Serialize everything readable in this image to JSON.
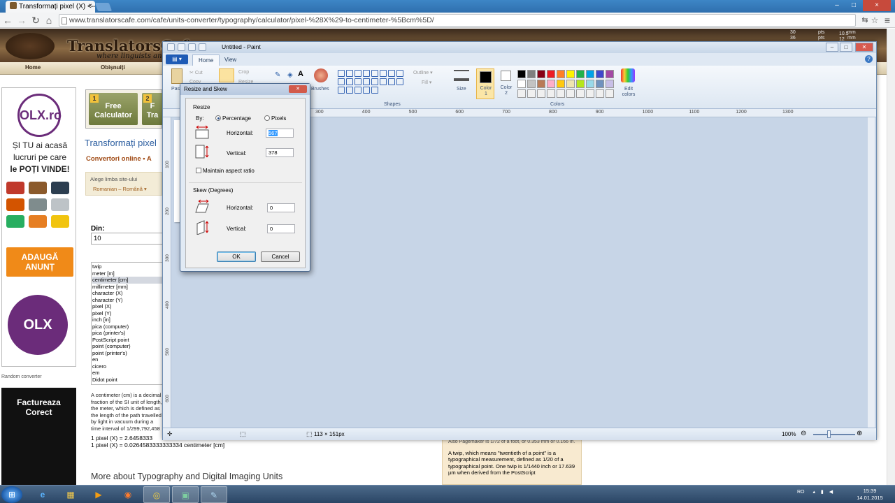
{
  "browser": {
    "tab_title": "Transformați pixel (X) <--",
    "tab_close": "×",
    "url": "www.translatorscafe.com/cafe/units-converter/typography/calculator/pixel-%28X%29-to-centimeter-%5Bcm%5D/",
    "win_min": "–",
    "win_max": "□",
    "win_close": "×"
  },
  "site": {
    "logo": "TranslatorsCafe",
    "tagline": "where linguists and",
    "nav": [
      "Home",
      "Obișnuiți"
    ],
    "right_widget": [
      "30",
      "pts",
      "mm",
      "36",
      "pts",
      "mm",
      "10.5",
      "12",
      "mm"
    ]
  },
  "ad_left": {
    "olx": "OLX.ro",
    "text_lines": [
      "ȘI TU ai acasă",
      "lucruri pe care",
      "le POȚI VINDE!"
    ],
    "button": [
      "ADAUGĂ",
      "ANUNȚ"
    ],
    "badge": "OLX",
    "random_converter": "Random converter",
    "ad2": [
      "Factureaza",
      "Corect"
    ]
  },
  "calc_tiles": [
    {
      "num": "1",
      "label_1": "Free",
      "label_2": "Calculator"
    },
    {
      "num": "2",
      "label_1": "F",
      "label_2": "Tra"
    }
  ],
  "main": {
    "heading": "Transformați pixel",
    "subnav": "Convertori online • A",
    "lang_label": "Alege limba site-ului",
    "lang_select": "Romanian – Română",
    "from_label": "Din:",
    "from_value": "10",
    "units": [
      "twip",
      "meter [m]",
      "centimeter [cm]",
      "millimeter [mm]",
      "character (X)",
      "character (Y)",
      "pixel (X)",
      "pixel (Y)",
      "inch [in]",
      "pica (computer)",
      "pica (printer's)",
      "PostScript point",
      "point (computer)",
      "point (printer's)",
      "en",
      "cicero",
      "em",
      "Didot point"
    ],
    "selected_unit": "centimeter [cm]",
    "definition": "A centimeter (cm) is a decimal fraction of the SI unit of length, the meter, which is defined as the length of the path travelled by light in vacuum during a time interval of 1/299,792,458 of a second. For comparison and conversion",
    "result_1": "1 pixel (X) = 2.6458333",
    "result_2": "1 pixel (X) = 0.0264583333333334 centimeter [cm]",
    "more_about": "More about Typography and Digital Imaging Units",
    "twip_top": "Also Pagemaker is 1/72 of a foot, or 0.353 mm or 0.166 in.",
    "twip_text": "A twip, which means \"twentieth of a point\" is a typographical measurement, defined as 1/20 of a typographical point. One twip is 1/1440 inch or 17.639 µm when derived from the PostScript"
  },
  "paint": {
    "title": "Untitled - Paint",
    "file_menu": "▤ ▾",
    "tabs": [
      "Home",
      "View"
    ],
    "clipboard": {
      "paste": "Paste",
      "cut": "Cut",
      "copy": "Copy"
    },
    "image": {
      "crop": "Crop",
      "resize": "Resize"
    },
    "brushes": "Brushes",
    "outline": "Outline",
    "fill": "Fill",
    "shapes": "Shapes",
    "size": "Size",
    "color1": [
      "Color",
      "1"
    ],
    "color2": [
      "Color",
      "2"
    ],
    "colors_label": "Colors",
    "edit_colors": [
      "Edit",
      "colors"
    ],
    "ruler_top": [
      "300",
      "400",
      "500",
      "600",
      "700",
      "800",
      "900",
      "1000",
      "1100",
      "1200",
      "1300"
    ],
    "ruler_left": [
      "100",
      "200",
      "300",
      "400",
      "500",
      "600"
    ],
    "image_size": "113 × 151px",
    "zoom": "100%",
    "zoom_minus": "⊖",
    "zoom_plus": "⊕",
    "colors": {
      "palette": [
        "#000000",
        "#7f7f7f",
        "#880015",
        "#ed1c24",
        "#ff7f27",
        "#fff200",
        "#22b14c",
        "#00a2e8",
        "#3f48cc",
        "#a349a4",
        "#ffffff",
        "#c3c3c3",
        "#b97a57",
        "#ffaec9",
        "#ffc90e",
        "#efe4b0",
        "#b5e61d",
        "#99d9ea",
        "#7092be",
        "#c8bfe7",
        "#f0f0f0",
        "#f0f0f0",
        "#f0f0f0",
        "#f0f0f0",
        "#f0f0f0",
        "#f0f0f0",
        "#f0f0f0",
        "#f0f0f0",
        "#f0f0f0",
        "#f0f0f0"
      ]
    }
  },
  "dialog": {
    "title": "Resize and Skew",
    "close": "✕",
    "resize_label": "Resize",
    "by_label": "By:",
    "percentage": "Percentage",
    "pixels": "Pixels",
    "horizontal_label": "Horizontal:",
    "horizontal_value": "567",
    "vertical_label": "Vertical:",
    "vertical_value": "378",
    "maintain_aspect": "Maintain aspect ratio",
    "skew_label": "Skew (Degrees)",
    "skew_h_label": "Horizontal:",
    "skew_h_value": "0",
    "skew_v_label": "Vertical:",
    "skew_v_value": "0",
    "ok": "OK",
    "cancel": "Cancel"
  },
  "taskbar": {
    "start": "⊞",
    "lang": "RO",
    "time": "15:39",
    "date": "14.01.2015"
  }
}
